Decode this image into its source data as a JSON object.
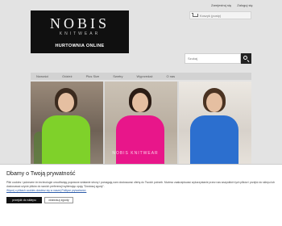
{
  "header": {
    "links": [
      "Zarejestruj się",
      "Zaloguj się"
    ],
    "logo": {
      "line1": "NOBIS",
      "line2": "KNITWEAR",
      "line3": "HURTOWNIA ONLINE"
    },
    "cart_label": "Koszyk (pusty)",
    "search": {
      "placeholder": "Szukaj"
    }
  },
  "nav": {
    "items": [
      "Nowości",
      "Odzież",
      "Plus Size",
      "Swetry",
      "Wyprzedaż",
      "O nas"
    ]
  },
  "hero": {
    "caption": "NOBIS KNITWEAR",
    "sweater_colors": [
      "#7fd12a",
      "#e8168a",
      "#2c6fcf"
    ]
  },
  "cookie": {
    "title": "Dbamy o Twoją prywatność",
    "text": "Pliki cookies i pokrewne im technologie umożliwiają poprawne działanie strony i pomagają nam dostosować ofertę do Twoich potrzeb. Możesz zaakceptować wykorzystanie przez nas wszystkich tych plików i przejść do sklepu lub dostosować użycie plików do swoich preferencji wybierając opcję \"Dostosuj zgody\".",
    "link": "Więcej o plikach cookies dowiesz się w naszej Polityce prywatności.",
    "accept_label": "przejdź do sklepu",
    "settings_label": "dostosuj zgody"
  }
}
